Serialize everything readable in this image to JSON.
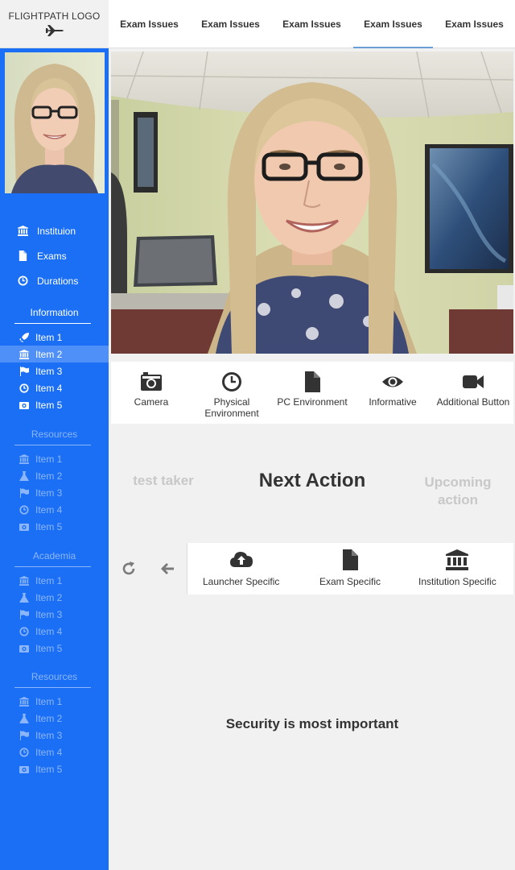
{
  "logo": {
    "text": "FLIGHTPATH LOGO",
    "icon": "jet-icon"
  },
  "tabs": [
    {
      "label": "Exam Issues",
      "active": false
    },
    {
      "label": "Exam Issues",
      "active": false
    },
    {
      "label": "Exam Issues",
      "active": false
    },
    {
      "label": "Exam Issues",
      "active": true
    },
    {
      "label": "Exam Issues",
      "active": false
    }
  ],
  "sidebar": {
    "main_nav": [
      {
        "label": "Instituion",
        "icon": "institution-icon"
      },
      {
        "label": "Exams",
        "icon": "file-icon"
      },
      {
        "label": "Durations",
        "icon": "clock-icon"
      }
    ],
    "sections": [
      {
        "title": "Information",
        "state": "active",
        "items": [
          {
            "label": "Item 1",
            "icon": "rocket-icon"
          },
          {
            "label": "Item 2",
            "icon": "institution-icon",
            "selected": true
          },
          {
            "label": "Item 3",
            "icon": "flag-icon"
          },
          {
            "label": "Item 4",
            "icon": "clock-icon"
          },
          {
            "label": "Item 5",
            "icon": "camera-icon"
          }
        ]
      },
      {
        "title": "Resources",
        "state": "muted",
        "items": [
          {
            "label": "Item 1",
            "icon": "institution-icon"
          },
          {
            "label": "Item 2",
            "icon": "flask-icon"
          },
          {
            "label": "Item 3",
            "icon": "flag-icon"
          },
          {
            "label": "Item 4",
            "icon": "clock-icon"
          },
          {
            "label": "Item 5",
            "icon": "camera-icon"
          }
        ]
      },
      {
        "title": "Academia",
        "state": "muted",
        "items": [
          {
            "label": "Item 1",
            "icon": "institution-icon"
          },
          {
            "label": "Item 2",
            "icon": "flask-icon"
          },
          {
            "label": "Item 3",
            "icon": "flag-icon"
          },
          {
            "label": "Item 4",
            "icon": "clock-icon"
          },
          {
            "label": "Item 5",
            "icon": "camera-icon"
          }
        ]
      },
      {
        "title": "Resources",
        "state": "muted",
        "items": [
          {
            "label": "Item 1",
            "icon": "institution-icon"
          },
          {
            "label": "Item 2",
            "icon": "flask-icon"
          },
          {
            "label": "Item 3",
            "icon": "flag-icon"
          },
          {
            "label": "Item 4",
            "icon": "clock-icon"
          },
          {
            "label": "Item 5",
            "icon": "camera-icon"
          }
        ]
      }
    ]
  },
  "actions": [
    {
      "label": "Camera",
      "icon": "camera-icon"
    },
    {
      "label": "Physical Environment",
      "icon": "clock-icon"
    },
    {
      "label": "PC Environment",
      "icon": "file-icon"
    },
    {
      "label": "Informative",
      "icon": "eye-icon"
    },
    {
      "label": "Additional Button",
      "icon": "video-camera-icon"
    }
  ],
  "next_action": {
    "previous": "test taker",
    "current": "Next Action",
    "upcoming": "Upcoming action"
  },
  "toolbar": {
    "refresh_icon": "refresh-icon",
    "back_icon": "arrow-left-icon",
    "items": [
      {
        "label": "Launcher Specific",
        "icon": "cloud-upload-icon"
      },
      {
        "label": "Exam Specific",
        "icon": "file-icon"
      },
      {
        "label": "Institution Specific",
        "icon": "institution-icon"
      }
    ]
  },
  "bottom": {
    "message": "Security is most important"
  },
  "colors": {
    "sidebar": "#1a6ff5",
    "sidebar_selected": "#4f8ff8",
    "sidebar_muted": "#8cb6fb",
    "tab_underline": "#6a9fd8",
    "panel": "#f1f1f1",
    "text": "#333333"
  }
}
